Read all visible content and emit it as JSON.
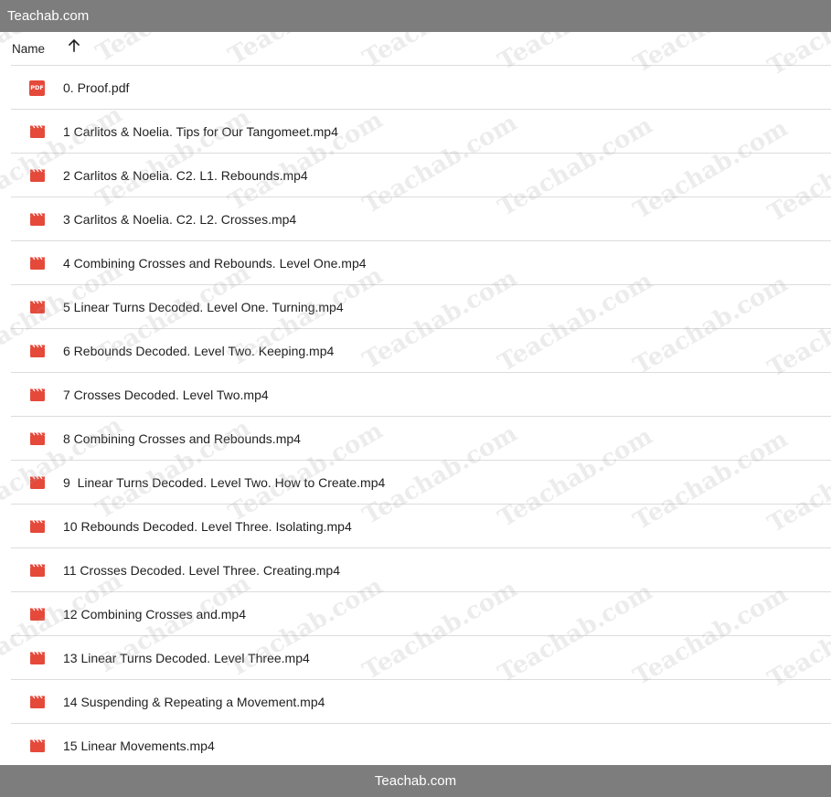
{
  "top_bar": {
    "title": "Teachab.com"
  },
  "bottom_bar": {
    "text": "Teachab.com"
  },
  "header": {
    "name_label": "Name",
    "sort_icon": "arrow-up-icon"
  },
  "watermark": {
    "text": "Teachab.com"
  },
  "files": [
    {
      "name": "0. Proof.pdf",
      "type": "pdf",
      "icon_label": "PDF"
    },
    {
      "name": "1 Carlitos & Noelia. Tips for Our Tangomeet.mp4",
      "type": "video"
    },
    {
      "name": "2 Carlitos & Noelia. C2. L1. Rebounds.mp4",
      "type": "video"
    },
    {
      "name": "3 Carlitos & Noelia. C2. L2. Crosses.mp4",
      "type": "video"
    },
    {
      "name": "4 Combining Crosses and Rebounds. Level One.mp4",
      "type": "video"
    },
    {
      "name": "5 Linear Turns Decoded. Level One. Turning.mp4",
      "type": "video"
    },
    {
      "name": "6 Rebounds Decoded. Level Two. Keeping.mp4",
      "type": "video"
    },
    {
      "name": "7 Crosses Decoded. Level Two.mp4",
      "type": "video"
    },
    {
      "name": "8 Combining Crosses and Rebounds.mp4",
      "type": "video"
    },
    {
      "name": "9  Linear Turns Decoded. Level Two. How to Create.mp4",
      "type": "video"
    },
    {
      "name": "10 Rebounds Decoded. Level Three. Isolating.mp4",
      "type": "video"
    },
    {
      "name": "11 Crosses Decoded. Level Three. Creating.mp4",
      "type": "video"
    },
    {
      "name": "12 Combining Crosses and.mp4",
      "type": "video"
    },
    {
      "name": "13 Linear Turns Decoded. Level Three.mp4",
      "type": "video"
    },
    {
      "name": "14 Suspending & Repeating a Movement.mp4",
      "type": "video"
    },
    {
      "name": "15 Linear Movements.mp4",
      "type": "video"
    }
  ],
  "colors": {
    "bar_background": "#7d7d7d",
    "video_icon": "#e5493a",
    "pdf_icon": "#e5493a",
    "divider": "#dcdcdc"
  }
}
